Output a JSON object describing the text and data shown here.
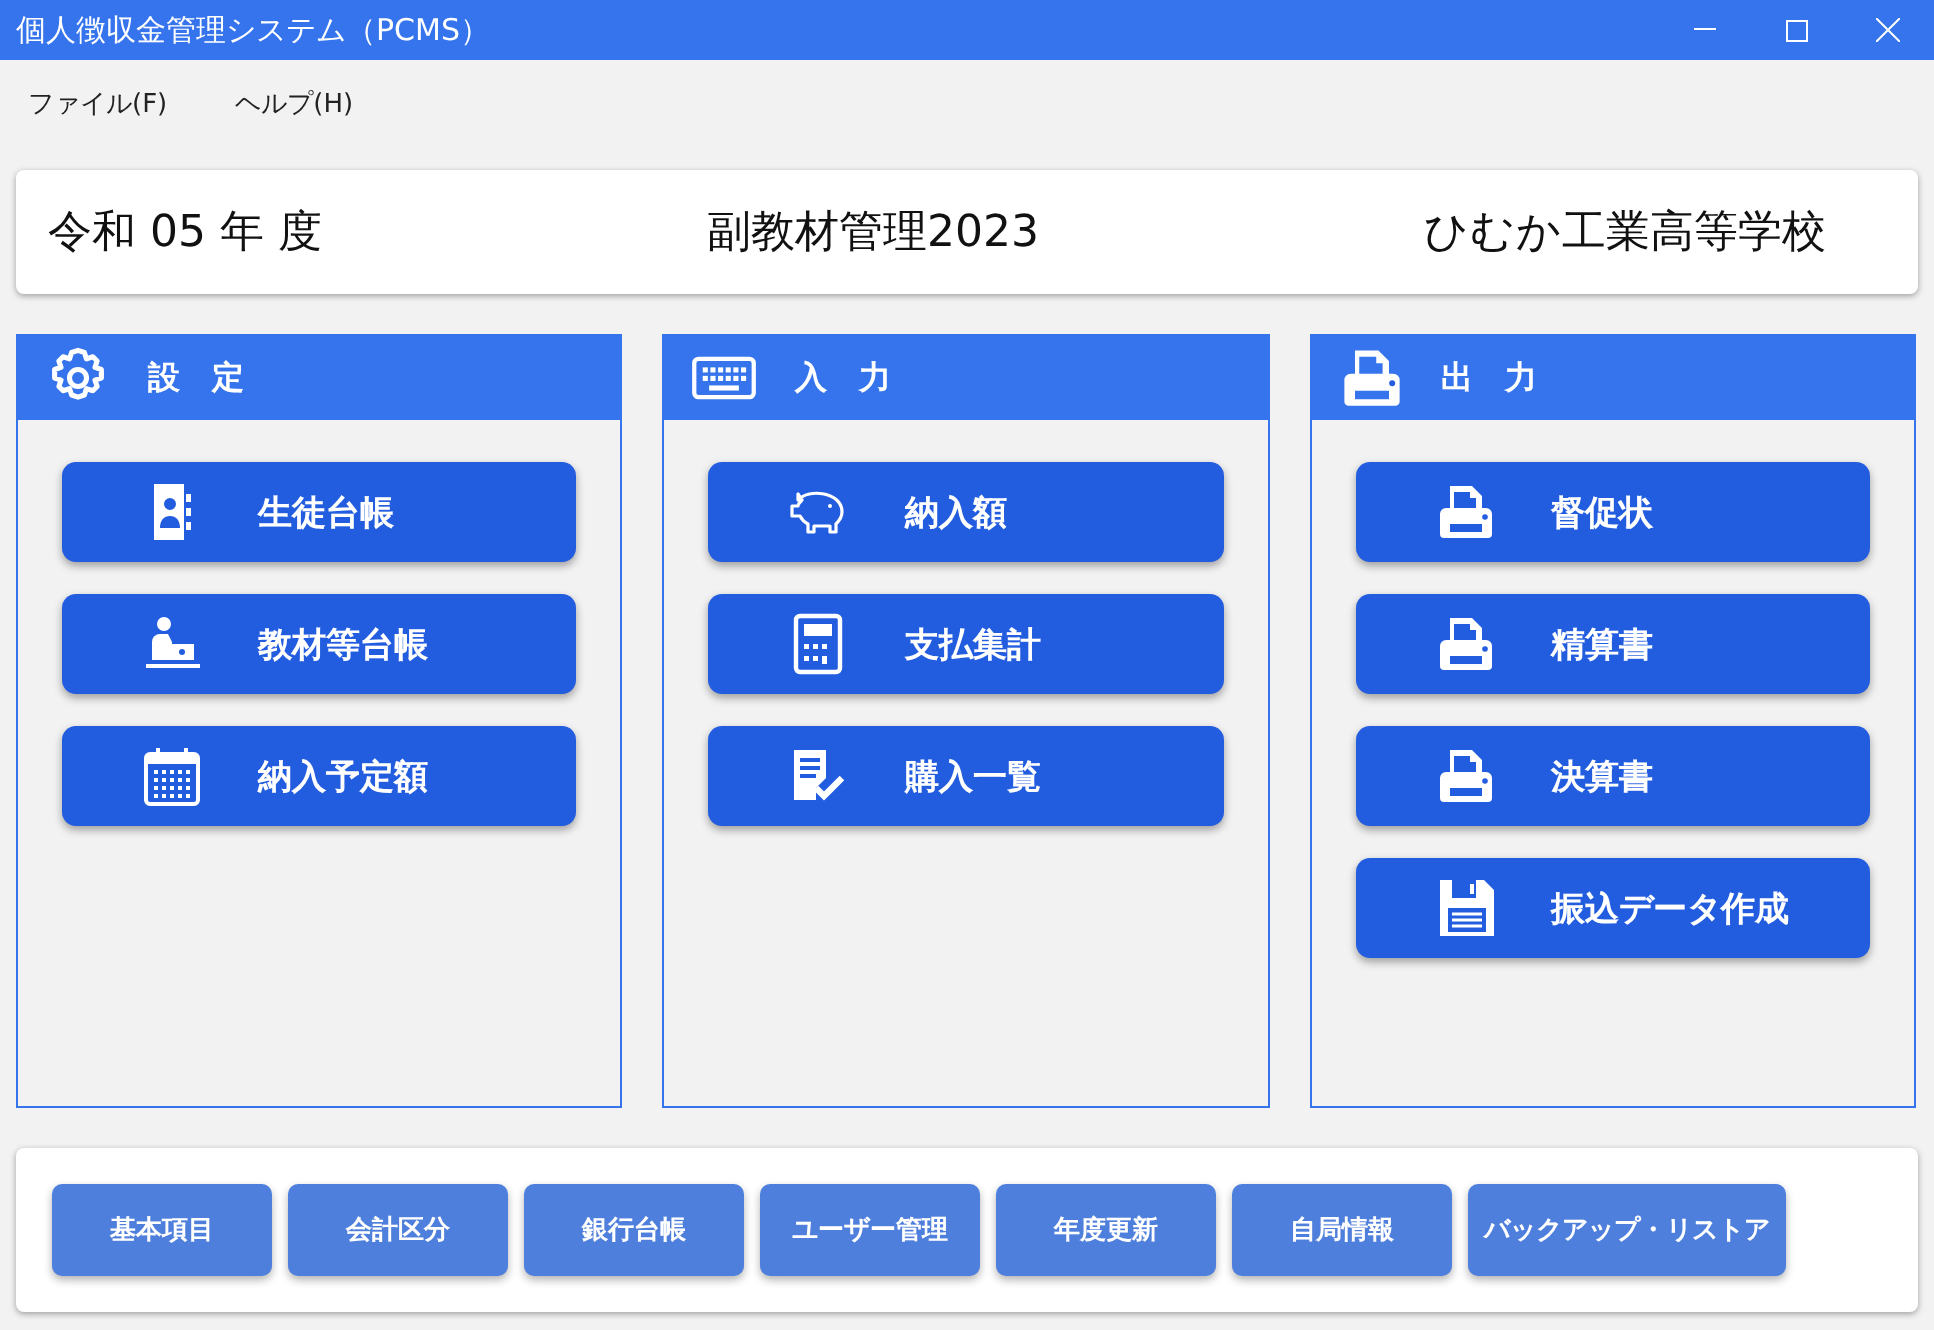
{
  "window": {
    "title": "個人徴収金管理システム（PCMS）"
  },
  "menu": [
    "ファイル(F)",
    "ヘルプ(H)"
  ],
  "header": {
    "year": "令和 05 年 度",
    "subject": "副教材管理2023",
    "school": "ひむか工業高等学校"
  },
  "panels": [
    {
      "title": "設　定",
      "kind": "gear",
      "buttons": [
        {
          "label": "生徒台帳",
          "kind": "contacts"
        },
        {
          "label": "教材等台帳",
          "kind": "teacher"
        },
        {
          "label": "納入予定額",
          "kind": "calendar"
        }
      ]
    },
    {
      "title": "入　力",
      "kind": "keyboard",
      "buttons": [
        {
          "label": "納入額",
          "kind": "piggy"
        },
        {
          "label": "支払集計",
          "kind": "calculator"
        },
        {
          "label": "購入一覧",
          "kind": "checklist"
        }
      ]
    },
    {
      "title": "出　力",
      "kind": "printer",
      "buttons": [
        {
          "label": "督促状",
          "kind": "printer"
        },
        {
          "label": "精算書",
          "kind": "printer"
        },
        {
          "label": "決算書",
          "kind": "printer"
        },
        {
          "label": "振込データ作成",
          "kind": "floppy"
        }
      ]
    }
  ],
  "footer_buttons": [
    "基本項目",
    "会計区分",
    "銀行台帳",
    "ユーザー管理",
    "年度更新",
    "自局情報",
    "バックアップ・リストア"
  ]
}
